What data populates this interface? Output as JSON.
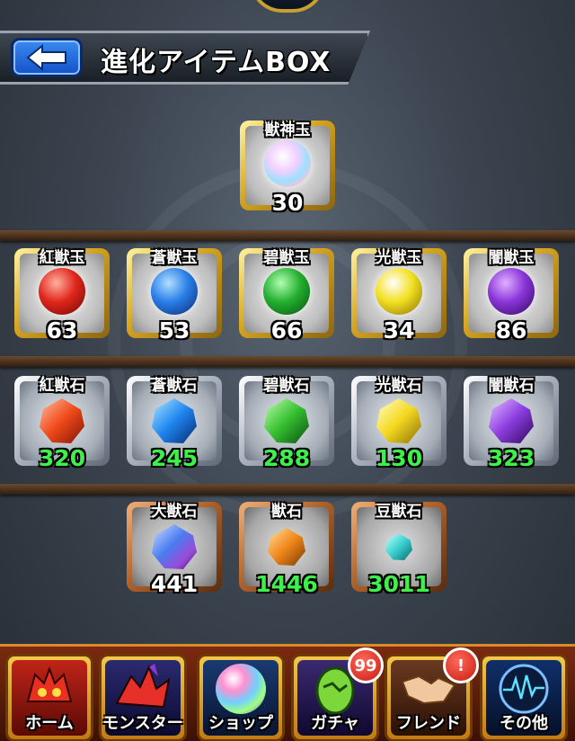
{
  "header": {
    "title": "進化アイテムBOX",
    "back_icon": "arrow-left-icon"
  },
  "special_item": {
    "name": "獣神玉",
    "count": "30",
    "color": "#e8d8ff"
  },
  "orbs": [
    {
      "name": "紅獣玉",
      "count": "63",
      "color": "#e0261b"
    },
    {
      "name": "蒼獣玉",
      "count": "53",
      "color": "#2a7ee8"
    },
    {
      "name": "碧獣玉",
      "count": "66",
      "color": "#24b030"
    },
    {
      "name": "光獣玉",
      "count": "34",
      "color": "#f2e020"
    },
    {
      "name": "闇獣玉",
      "count": "86",
      "color": "#8a35d8"
    }
  ],
  "stones": [
    {
      "name": "紅獣石",
      "count": "320",
      "color": "#f04a1a"
    },
    {
      "name": "蒼獣石",
      "count": "245",
      "color": "#1f86f0"
    },
    {
      "name": "碧獣石",
      "count": "288",
      "color": "#36c030"
    },
    {
      "name": "光獣石",
      "count": "130",
      "color": "#f5d820"
    },
    {
      "name": "闇獣石",
      "count": "323",
      "color": "#8c3ee0"
    }
  ],
  "generic_stones": [
    {
      "name": "大獣石",
      "count": "441",
      "color": "#4a7df0",
      "count_color": "white"
    },
    {
      "name": "獣石",
      "count": "1446",
      "color": "#f0881a",
      "count_color": "green"
    },
    {
      "name": "豆獣石",
      "count": "3011",
      "color": "#3ad0d0",
      "count_color": "green"
    }
  ],
  "nav": {
    "home": "ホーム",
    "monster": "モンスター",
    "shop": "ショップ",
    "gacha": "ガチャ",
    "gacha_badge": "99",
    "friend": "フレンド",
    "friend_badge": "!",
    "other": "その他"
  }
}
